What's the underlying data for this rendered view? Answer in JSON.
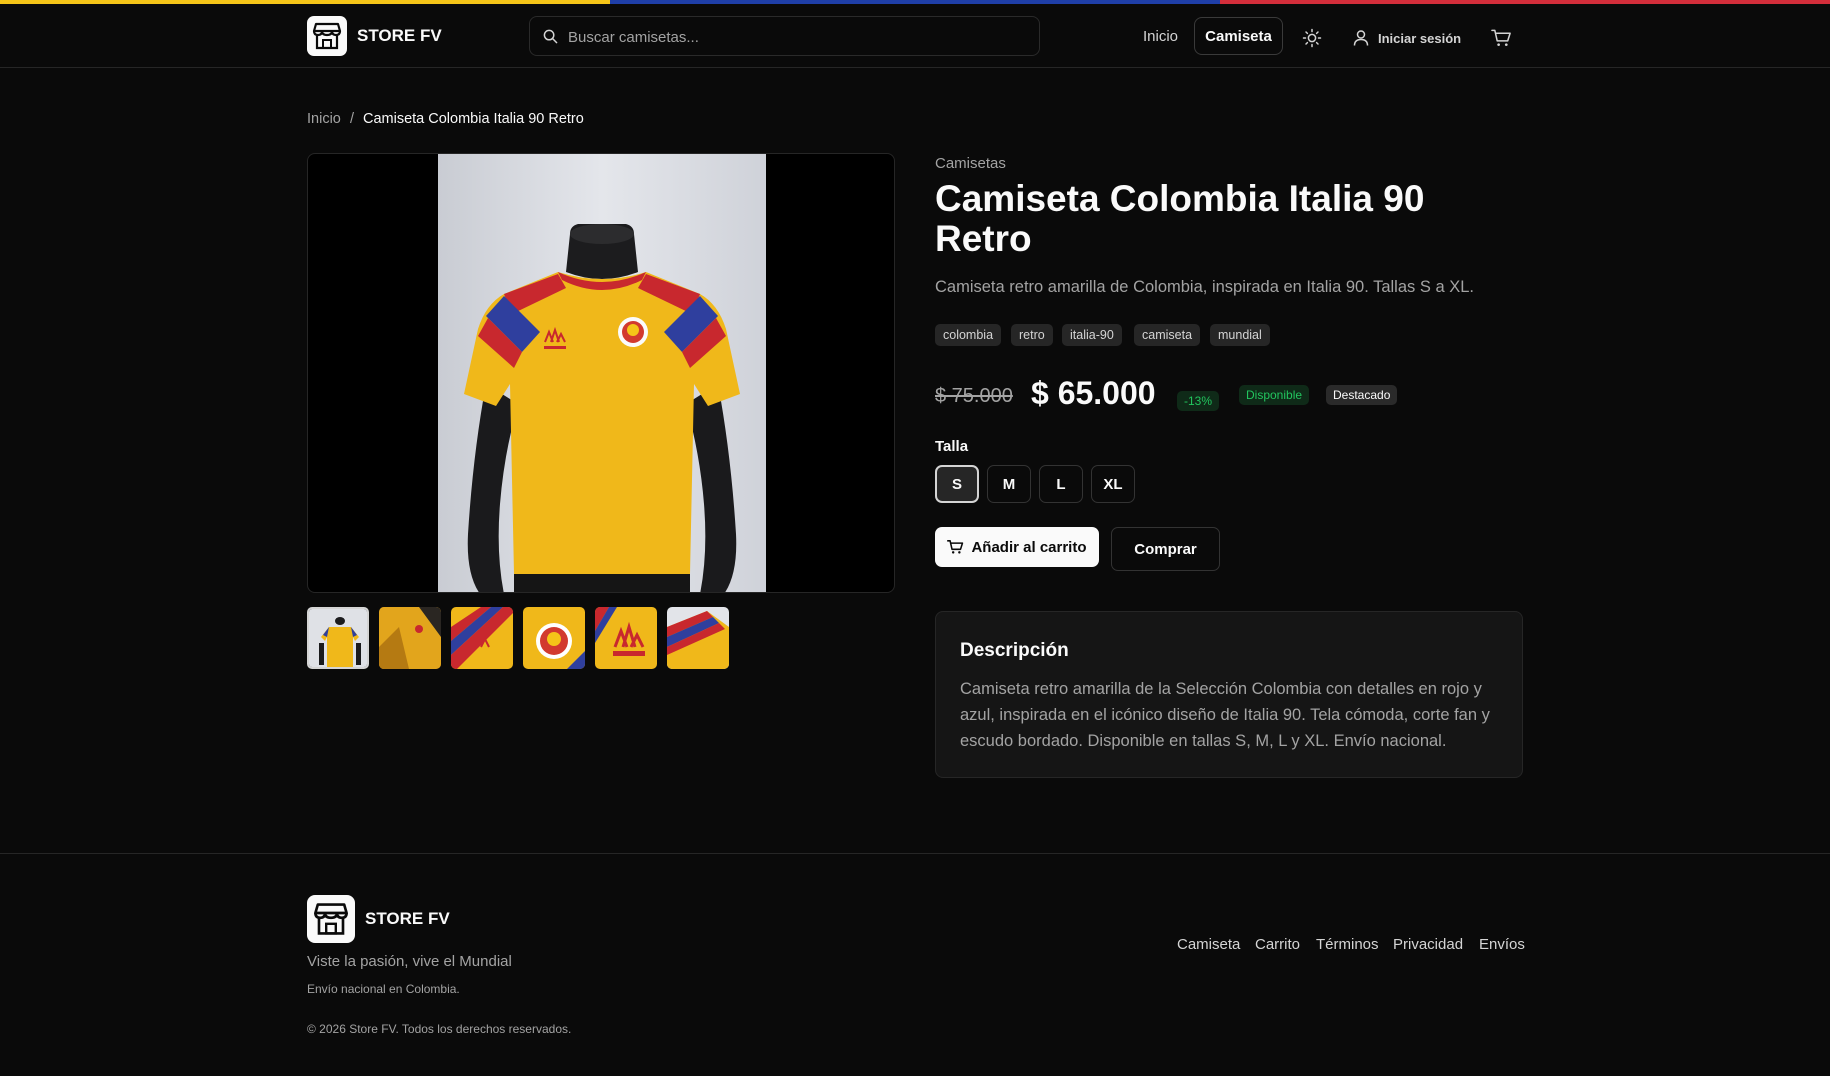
{
  "colors": {
    "flag_yellow": "#f5c518",
    "flag_blue": "#1f3fa8",
    "flag_red": "#d42e3b",
    "background": "#0a0a0a",
    "success": "#22c55e"
  },
  "header": {
    "brand": "STORE FV",
    "search_placeholder": "Buscar camisetas...",
    "nav_home": "Inicio",
    "nav_active": "Camiseta",
    "login": "Iniciar sesión",
    "icons": [
      "store-icon",
      "search-icon",
      "sun-icon",
      "user-icon",
      "cart-icon"
    ]
  },
  "breadcrumb": {
    "home": "Inicio",
    "separator": "/",
    "current": "Camiseta Colombia Italia 90 Retro"
  },
  "gallery": {
    "thumbnail_count": 6,
    "selected_thumbnail": 1
  },
  "product": {
    "category": "Camisetas",
    "title": "Camiseta Colombia Italia 90 Retro",
    "subtitle": "Camiseta retro amarilla de Colombia, inspirada en Italia 90. Tallas S a XL.",
    "tags": [
      "colombia",
      "retro",
      "italia-90",
      "camiseta",
      "mundial"
    ],
    "old_price": "$ 75.000",
    "price": "$ 65.000",
    "discount": "-13%",
    "availability": "Disponible",
    "featured": "Destacado",
    "size_label": "Talla",
    "sizes": [
      "S",
      "M",
      "L",
      "XL"
    ],
    "selected_size": "S",
    "add_to_cart": "Añadir al carrito",
    "buy": "Comprar",
    "description_title": "Descripción",
    "description": "Camiseta retro amarilla de la Selección Colombia con detalles en rojo y azul, inspirada en el icónico diseño de Italia 90. Tela cómoda, corte fan y escudo bordado. Disponible en tallas S, M, L y XL. Envío nacional."
  },
  "footer": {
    "brand": "STORE FV",
    "tagline": "Viste la pasión, vive el Mundial",
    "shipping": "Envío nacional en Colombia.",
    "copyright": "© 2026 Store FV. Todos los derechos reservados.",
    "links": [
      "Camiseta",
      "Carrito",
      "Términos",
      "Privacidad",
      "Envíos"
    ]
  }
}
